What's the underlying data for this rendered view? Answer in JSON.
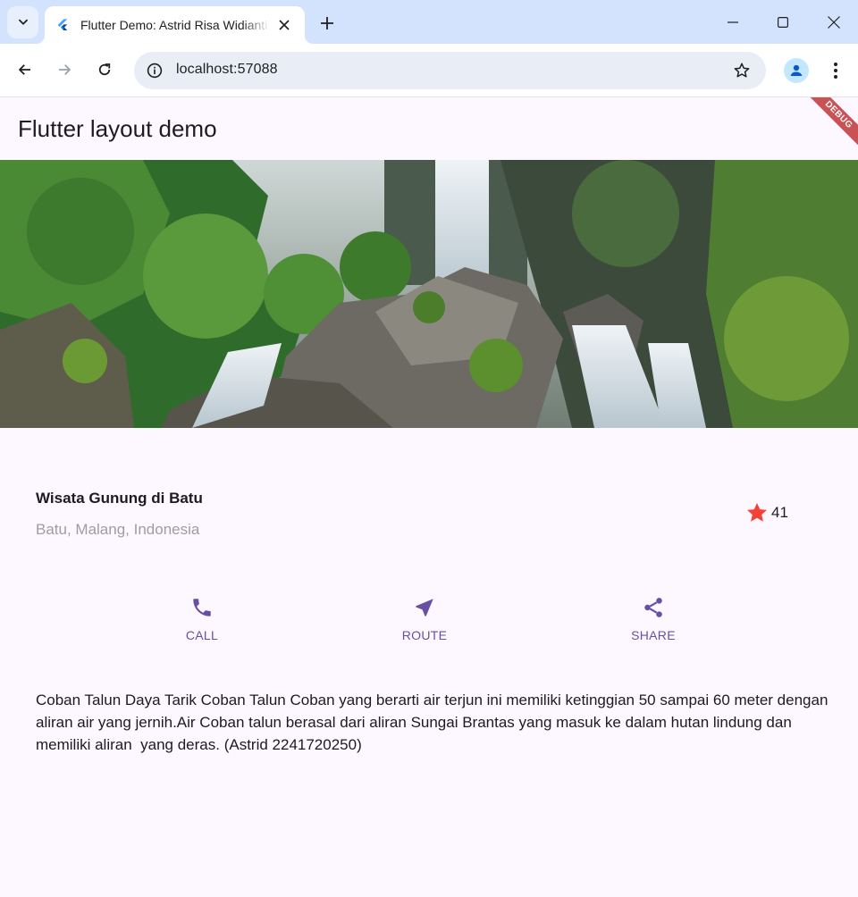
{
  "browser": {
    "tab_title": "Flutter Demo: Astrid Risa Widianti",
    "url": "localhost:57088",
    "icons": {
      "tab_search": "chevron-down-icon",
      "favicon": "flutter-logo-icon",
      "tab_close": "close-icon",
      "new_tab": "plus-icon",
      "back": "arrow-left-icon",
      "forward": "arrow-right-icon",
      "reload": "reload-icon",
      "site_info": "info-icon",
      "bookmark": "star-outline-icon",
      "profile": "person-icon",
      "menu": "more-vert-icon",
      "minimize": "minimize-icon",
      "maximize": "maximize-icon",
      "close_window": "close-icon"
    }
  },
  "app": {
    "appbar_title": "Flutter layout demo",
    "debug_label": "DEBUG",
    "place": {
      "name": "Wisata Gunung di Batu",
      "location": "Batu, Malang, Indonesia",
      "rating_count": "41",
      "rating_icon": "star-icon"
    },
    "buttons": [
      {
        "label": "CALL",
        "icon": "phone-icon"
      },
      {
        "label": "ROUTE",
        "icon": "near-me-icon"
      },
      {
        "label": "SHARE",
        "icon": "share-icon"
      }
    ],
    "description": "Coban Talun Daya Tarik Coban Talun Coban yang berarti air terjun ini memiliki ketinggian 50 sampai 60 meter dengan aliran air yang jernih.Air Coban talun berasal dari aliran Sungai Brantas yang masuk ke dalam hutan lindung dan memiliki aliran  yang deras. (Astrid 2241720250)",
    "colors": {
      "primary": "#6750a4",
      "star": "#f44336",
      "background": "#fdf7ff",
      "debug_banner": "#b71c1c"
    }
  }
}
